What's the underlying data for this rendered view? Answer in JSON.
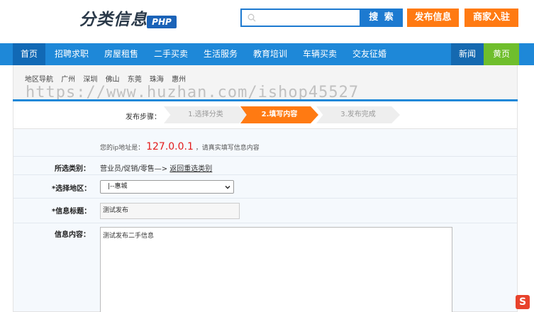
{
  "header": {
    "logo_text": "分类信息",
    "logo_badge": "PHP",
    "search_placeholder": "",
    "search_button": "搜 索",
    "publish_button": "发布信息",
    "merchant_button": "商家入驻"
  },
  "nav": {
    "items": [
      "首页",
      "招聘求职",
      "房屋租售",
      "二手买卖",
      "生活服务",
      "教育培训",
      "车辆买卖",
      "交友征婚"
    ],
    "news": "新闻",
    "yellow_pages": "黄页"
  },
  "region": {
    "label": "地区导航",
    "cities": [
      "广州",
      "深圳",
      "佛山",
      "东莞",
      "珠海",
      "惠州"
    ]
  },
  "watermark": "https://www.huzhan.com/ishop45527",
  "steps": {
    "label": "发布步骤：",
    "step1": "1.选择分类",
    "step2": "2.填写内容",
    "step3": "3.发布完成"
  },
  "form": {
    "ip_prefix": "您的ip地址是：",
    "ip_value": "127.0.0.1",
    "ip_suffix": "，请真实填写信息内容",
    "category_label": "所选类别：",
    "category_value": "营业员/促销/零售—>",
    "category_link": "返回重选类别",
    "region_label": "*选择地区：",
    "region_value": "|--惠城",
    "title_label": "*信息标题：",
    "title_value": "测试发布",
    "content_label": "信息内容：",
    "content_value": "测试发布二手信息"
  },
  "corner_icon_letter": "S"
}
